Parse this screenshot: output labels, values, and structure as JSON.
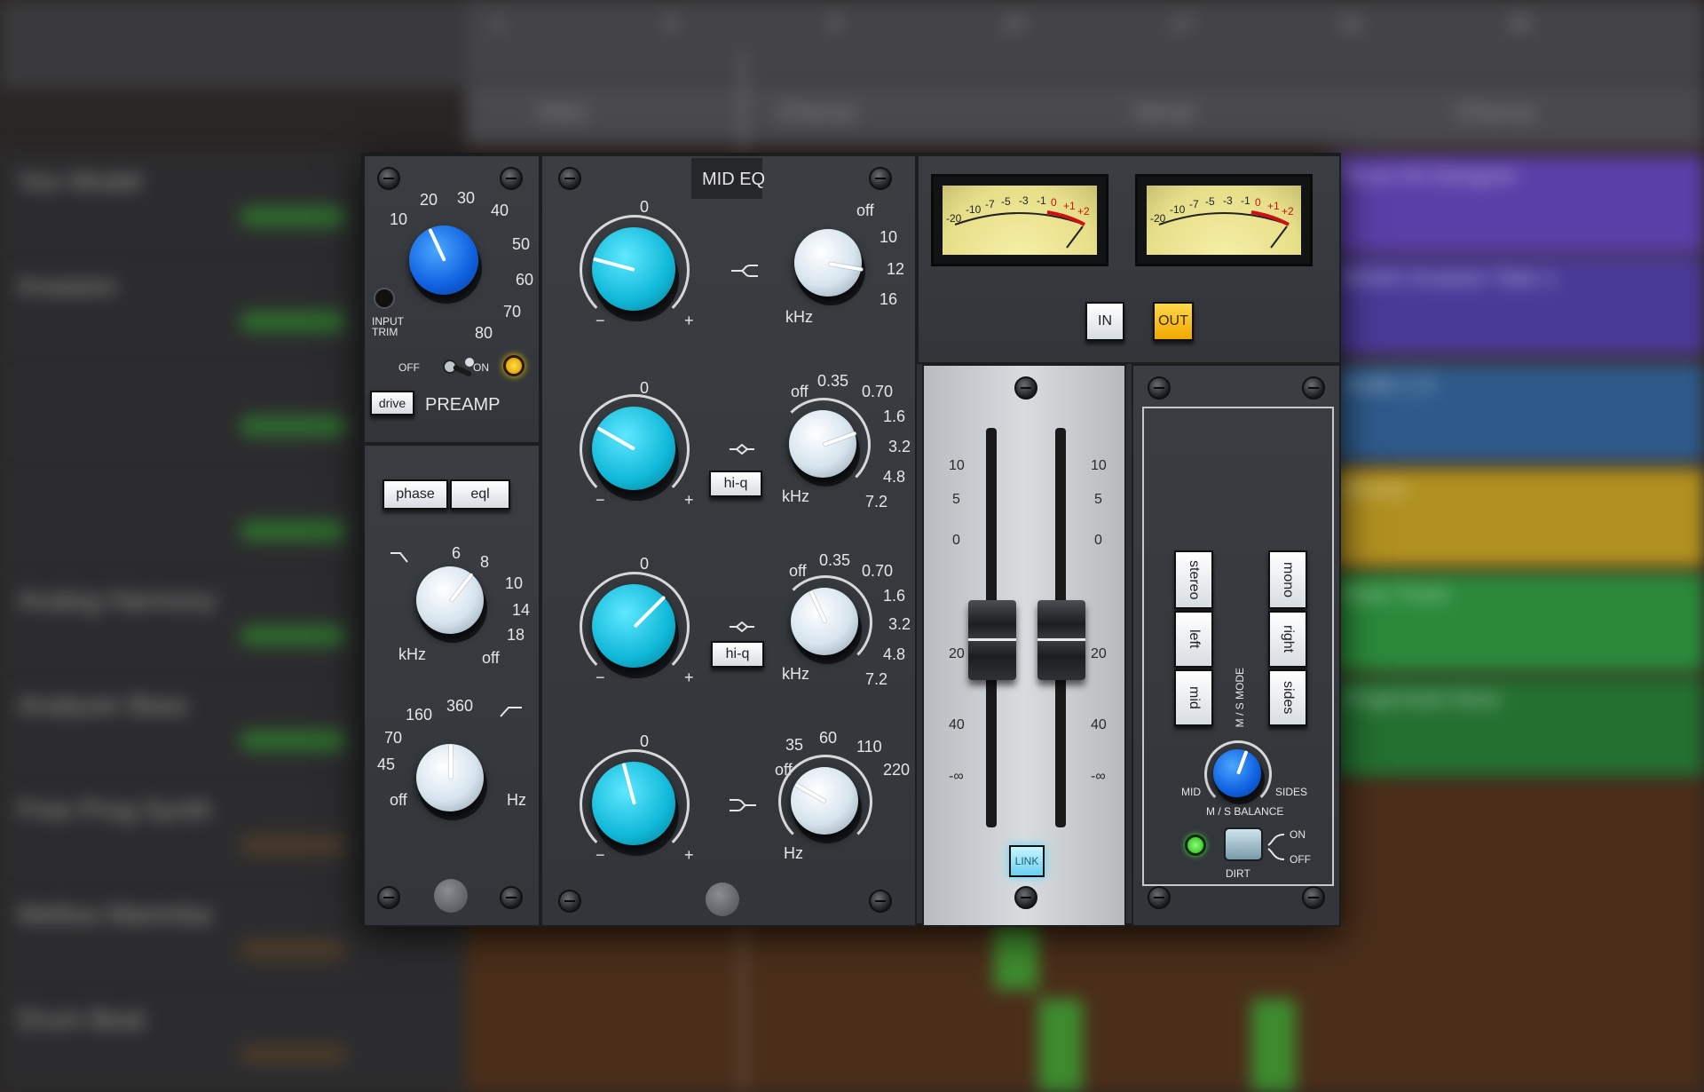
{
  "daw": {
    "ruler_numbers": [
      "1",
      "5",
      "9",
      "13",
      "17",
      "21",
      "25"
    ],
    "markers": [
      "Intro",
      "Chorus",
      "Verse",
      "Chorus"
    ],
    "tracks": [
      "Vox Model",
      "Invasion",
      "",
      "",
      "Analog Harmony",
      "Analyzer Bass",
      "Free Prog Synth",
      "Mellow Marimba",
      "Drum Beat"
    ],
    "regions": [
      "Drum Kit Designer",
      "British Invasion Take 1",
      "Audio 1.5",
      "Drums",
      "Bass Track",
      "Fingerstyle Bass"
    ]
  },
  "preamp": {
    "input_knob_scale": [
      "10",
      "20",
      "30",
      "40",
      "50",
      "60",
      "70",
      "80"
    ],
    "input_trim_label": "INPUT\nTRIM",
    "off_label": "OFF",
    "on_label": "ON",
    "drive_label": "drive",
    "title": "PREAMP",
    "phase_label": "phase",
    "eql_label": "eql",
    "hpf_scale": [
      "6",
      "8",
      "10",
      "14",
      "18",
      "off"
    ],
    "hpf_unit": "kHz",
    "lpf_scale": [
      "off",
      "45",
      "70",
      "160",
      "360"
    ],
    "lpf_unit": "Hz"
  },
  "eq": {
    "title": "MID EQ",
    "bands": [
      {
        "gain_label": "0",
        "freq_scale": [
          "off",
          "10",
          "12",
          "16"
        ],
        "freq_unit": "kHz",
        "hiq_label": ""
      },
      {
        "gain_label": "0",
        "freq_scale": [
          "off",
          "0.35",
          "0.70",
          "1.6",
          "3.2",
          "4.8",
          "7.2"
        ],
        "freq_unit": "kHz",
        "hiq_label": "hi-q"
      },
      {
        "gain_label": "0",
        "freq_scale": [
          "off",
          "0.35",
          "0.70",
          "1.6",
          "3.2",
          "4.8",
          "7.2"
        ],
        "freq_unit": "kHz",
        "hiq_label": "hi-q"
      },
      {
        "gain_label": "0",
        "freq_scale": [
          "off",
          "35",
          "60",
          "110",
          "220"
        ],
        "freq_unit": "Hz",
        "hiq_label": ""
      }
    ],
    "minus": "−",
    "plus": "+"
  },
  "output": {
    "vu_scale": [
      "-20",
      "-10",
      "-7",
      "-5",
      "-3",
      "-1",
      "0",
      "+1",
      "+2"
    ],
    "in_label": "IN",
    "out_label": "OUT",
    "fader_scale": [
      "10",
      "5",
      "0",
      "20",
      "40",
      "-∞"
    ],
    "link_label": "LINK"
  },
  "ms": {
    "left_buttons": [
      "stereo",
      "left",
      "mid"
    ],
    "right_buttons": [
      "mono",
      "right",
      "sides"
    ],
    "mode_label": "M / S MODE",
    "mid_label": "MID",
    "sides_label": "SIDES",
    "balance_label": "M / S BALANCE",
    "dirt_label": "DIRT",
    "on_label": "ON",
    "off_label": "OFF"
  },
  "colors": {
    "cyan_knob": "#10b8d8",
    "blue_knob": "#1060e0",
    "out_active": "#f0b400",
    "lamp": "#f0c000",
    "green_led": "#40e040"
  },
  "state": {
    "out_active": true,
    "preamp_on": true,
    "link_active": true
  }
}
